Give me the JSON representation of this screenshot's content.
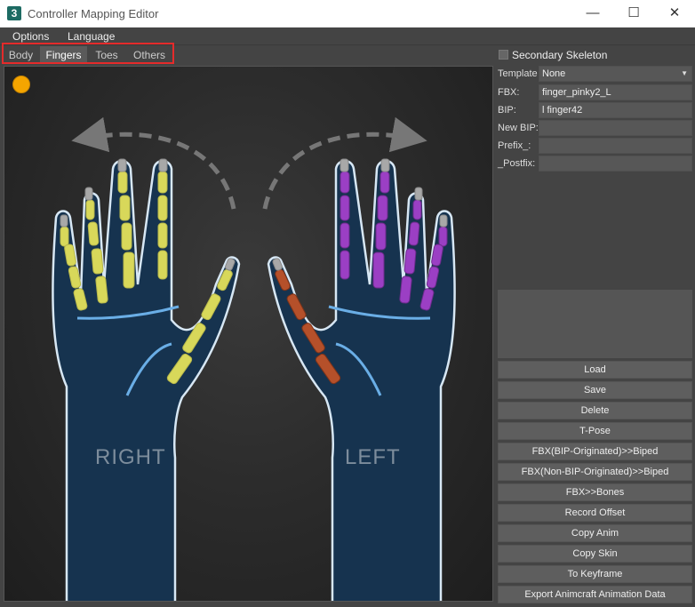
{
  "window": {
    "app_icon": "3",
    "title": "Controller Mapping Editor",
    "minimize_icon": "—",
    "maximize_icon": "☐",
    "close_icon": "✕"
  },
  "menu": {
    "items": [
      "Options",
      "Language"
    ]
  },
  "tabs": {
    "items": [
      "Body",
      "Fingers",
      "Toes",
      "Others"
    ],
    "active": "Fingers"
  },
  "viewport": {
    "right_label": "RIGHT",
    "left_label": "LEFT",
    "status_color": "#f5a500"
  },
  "panel": {
    "secondary_skeleton_label": "Secondary Skeleton",
    "secondary_skeleton_checked": false,
    "fields": {
      "template": {
        "label": "Template",
        "value": "None"
      },
      "fbx": {
        "label": "FBX:",
        "value": "finger_pinky2_L"
      },
      "bip": {
        "label": "BIP:",
        "value": "l finger42"
      },
      "new_bip": {
        "label": "New BIP:",
        "value": ""
      },
      "prefix": {
        "label": "Prefix_:",
        "value": ""
      },
      "postfix": {
        "label": "_Postfix:",
        "value": ""
      }
    },
    "buttons": [
      "Load",
      "Save",
      "Delete",
      "T-Pose",
      "FBX(BIP-Originated)>>Biped",
      "FBX(Non-BIP-Originated)>>Biped",
      "FBX>>Bones",
      "Record Offset",
      "Copy Anim",
      "Copy Skin",
      "To Keyframe",
      "Export Animcraft Animation Data"
    ]
  },
  "colors": {
    "right_bones": "#d8d85a",
    "left_bones": "#9b3fc4",
    "left_thumb": "#b5502a",
    "hand": "#16334f",
    "hand_outline": "#d7e7f4"
  }
}
